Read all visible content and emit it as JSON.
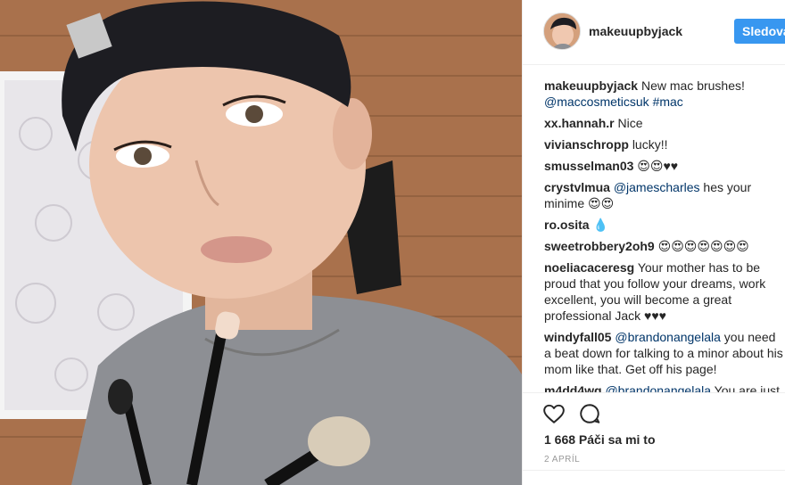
{
  "post": {
    "username": "makeuupbyjack",
    "follow_label": "Sledova",
    "likes_text": "1 668 Páči sa mi to",
    "date_text": "2 APRÍL"
  },
  "comments": [
    {
      "user": "makeuupbyjack",
      "text": "New mac brushes!",
      "mentions": "@maccosmeticsuk #mac"
    },
    {
      "user": "xx.hannah.r",
      "text": "Nice"
    },
    {
      "user": "vivianschropp",
      "text": "lucky!!"
    },
    {
      "user": "smusselman03",
      "text": "😍😍♥♥"
    },
    {
      "user": "crystvlmua",
      "mention": "@jamescharles",
      "text": "hes your minime 😍😍"
    },
    {
      "user": "ro.osita",
      "text": "💧"
    },
    {
      "user": "sweetrobbery2oh9",
      "text": "😍😍😍😍😍😍😍"
    },
    {
      "user": "noeliacaceresg",
      "text": "Your mother has to be proud that you follow your dreams, work excellent, you will become a great professional Jack ♥♥♥"
    },
    {
      "user": "windyfall05",
      "mention": "@brandonangelala",
      "text": "you need a beat down for talking to a minor about his mom like that. Get off his page!"
    },
    {
      "user": "m4dd4wg",
      "mention": "@brandonangelala",
      "text": "You are just"
    }
  ],
  "icons": {
    "like": "heart-icon",
    "comment": "comment-icon"
  }
}
